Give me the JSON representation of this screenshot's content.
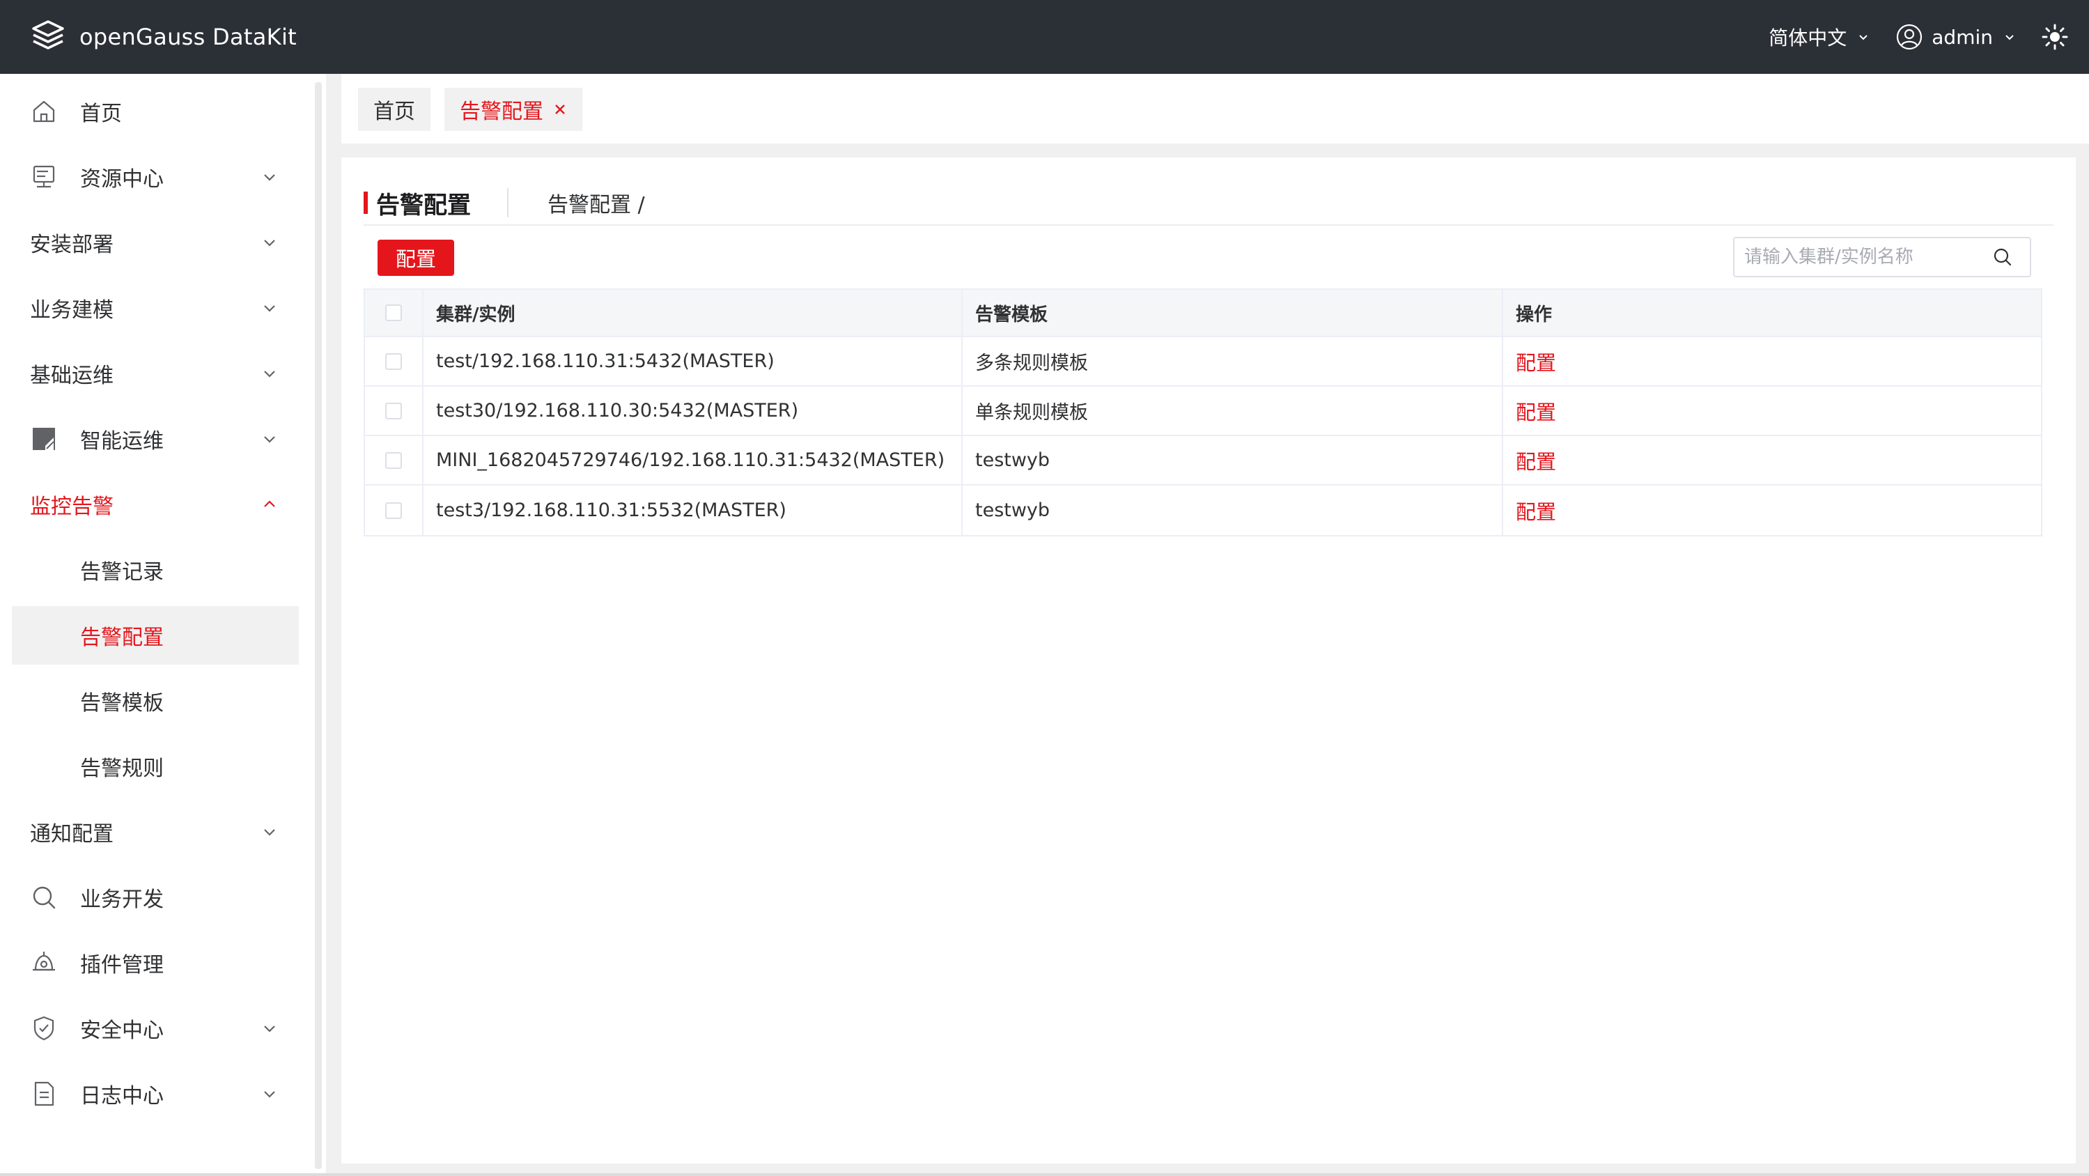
{
  "app": {
    "title": "openGauss DataKit"
  },
  "header": {
    "language": "简体中文",
    "user": "admin"
  },
  "sidebar": {
    "items": [
      {
        "label": "首页"
      },
      {
        "label": "资源中心"
      },
      {
        "label": "安装部署"
      },
      {
        "label": "业务建模"
      },
      {
        "label": "基础运维"
      },
      {
        "label": "智能运维"
      },
      {
        "label": "监控告警"
      },
      {
        "label": "告警记录"
      },
      {
        "label": "告警配置"
      },
      {
        "label": "告警模板"
      },
      {
        "label": "告警规则"
      },
      {
        "label": "通知配置"
      },
      {
        "label": "业务开发"
      },
      {
        "label": "插件管理"
      },
      {
        "label": "安全中心"
      },
      {
        "label": "日志中心"
      }
    ]
  },
  "tabs": [
    {
      "label": "首页"
    },
    {
      "label": "告警配置"
    }
  ],
  "page": {
    "title": "告警配置",
    "breadcrumb": "告警配置 /",
    "config_button": "配置",
    "search_placeholder": "请输入集群/实例名称"
  },
  "table": {
    "headers": [
      "集群/实例",
      "告警模板",
      "操作"
    ],
    "rows": [
      {
        "instance": "test/192.168.110.31:5432(MASTER)",
        "template": "多条规则模板",
        "action": "配置"
      },
      {
        "instance": "test30/192.168.110.30:5432(MASTER)",
        "template": "单条规则模板",
        "action": "配置"
      },
      {
        "instance": "MINI_1682045729746/192.168.110.31:5432(MASTER)",
        "template": "testwyb",
        "action": "配置"
      },
      {
        "instance": "test3/192.168.110.31:5532(MASTER)",
        "template": "testwyb",
        "action": "配置"
      }
    ]
  },
  "colors": {
    "accent": "#e4161c",
    "topbar": "#2b2f36"
  }
}
